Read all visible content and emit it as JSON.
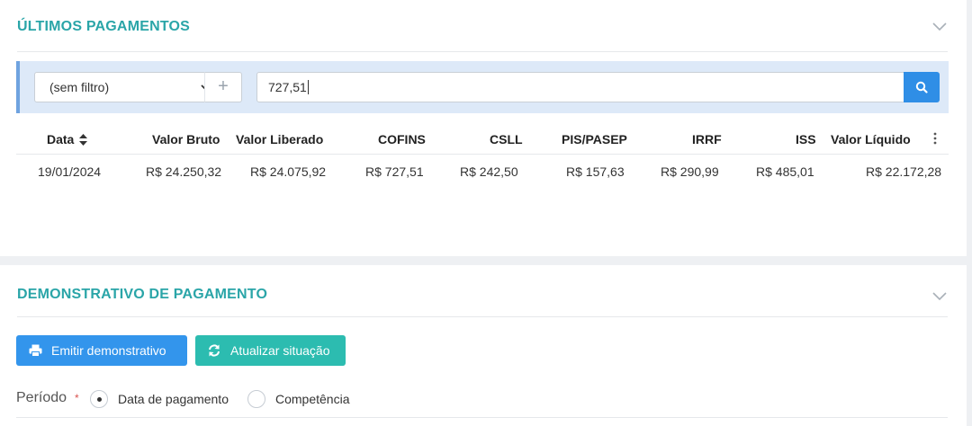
{
  "ultimos": {
    "title": "ÚLTIMOS PAGAMENTOS",
    "filter": {
      "select_value": "(sem filtro)",
      "add_label": "+",
      "search_value": "727,51"
    },
    "table": {
      "headers": [
        "Data",
        "Valor Bruto",
        "Valor Liberado",
        "COFINS",
        "CSLL",
        "PIS/PASEP",
        "IRRF",
        "ISS",
        "Valor Líquido"
      ],
      "rows": [
        [
          "19/01/2024",
          "R$ 24.250,32",
          "R$ 24.075,92",
          "R$ 727,51",
          "R$ 242,50",
          "R$ 157,63",
          "R$ 290,99",
          "R$ 485,01",
          "R$ 22.172,28"
        ]
      ]
    }
  },
  "demonstrativo": {
    "title": "DEMONSTRATIVO DE PAGAMENTO",
    "emit_label": "Emitir demonstrativo",
    "update_label": "Atualizar situação",
    "periodo_label": "Período",
    "required_mark": "*",
    "options": [
      "Data de pagamento",
      "Competência"
    ]
  },
  "colors": {
    "accent_teal": "#2aa5a8",
    "primary_blue": "#3395ec",
    "teal_button": "#2cbcb0",
    "filter_bg": "#dde9f8"
  },
  "icons": [
    "chevron-down-icon",
    "caret-down-icon",
    "plus-icon",
    "search-icon",
    "sort-icon",
    "kebab-menu-icon",
    "printer-icon",
    "refresh-icon"
  ]
}
